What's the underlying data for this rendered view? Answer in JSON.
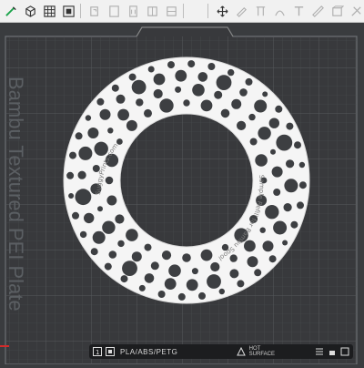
{
  "toolbar": {
    "tools": [
      {
        "icon": "add-cube-icon",
        "enabled": true
      },
      {
        "icon": "add-plate-icon",
        "enabled": true
      },
      {
        "icon": "arrange-grid-icon",
        "enabled": true
      },
      {
        "icon": "orient-icon",
        "enabled": true
      },
      {
        "icon": "copy-icon",
        "enabled": false
      },
      {
        "icon": "paste-icon",
        "enabled": false
      },
      {
        "icon": "delete-icon",
        "enabled": false
      },
      {
        "icon": "layer-icon",
        "enabled": false
      },
      {
        "icon": "split-icon",
        "enabled": false
      },
      {
        "icon": "move-icon",
        "enabled": true
      },
      {
        "icon": "paint-icon",
        "enabled": false
      },
      {
        "icon": "support-icon",
        "enabled": false
      },
      {
        "icon": "seam-icon",
        "enabled": false
      },
      {
        "icon": "text-icon",
        "enabled": false
      },
      {
        "icon": "measure-icon",
        "enabled": false
      },
      {
        "icon": "cut-icon",
        "enabled": false
      },
      {
        "icon": "assembly-icon",
        "enabled": false
      }
    ]
  },
  "plate": {
    "brand_text": "Bambu Textured PEI Plate",
    "model_text_left": "SuggyPrints.com",
    "model_text_right": "Sample Refill for Bambu Spool",
    "colors": {
      "plate_bg": "#3a3c3f",
      "grid_line": "#4d5053",
      "part": "#f4f4f4",
      "part_shadow": "#cfcfcf",
      "axis_red": "#d42a2a"
    }
  },
  "bottom": {
    "material": "PLA/ABS/PETG",
    "surface_line1": "HOT",
    "surface_line2": "SURFACE"
  }
}
